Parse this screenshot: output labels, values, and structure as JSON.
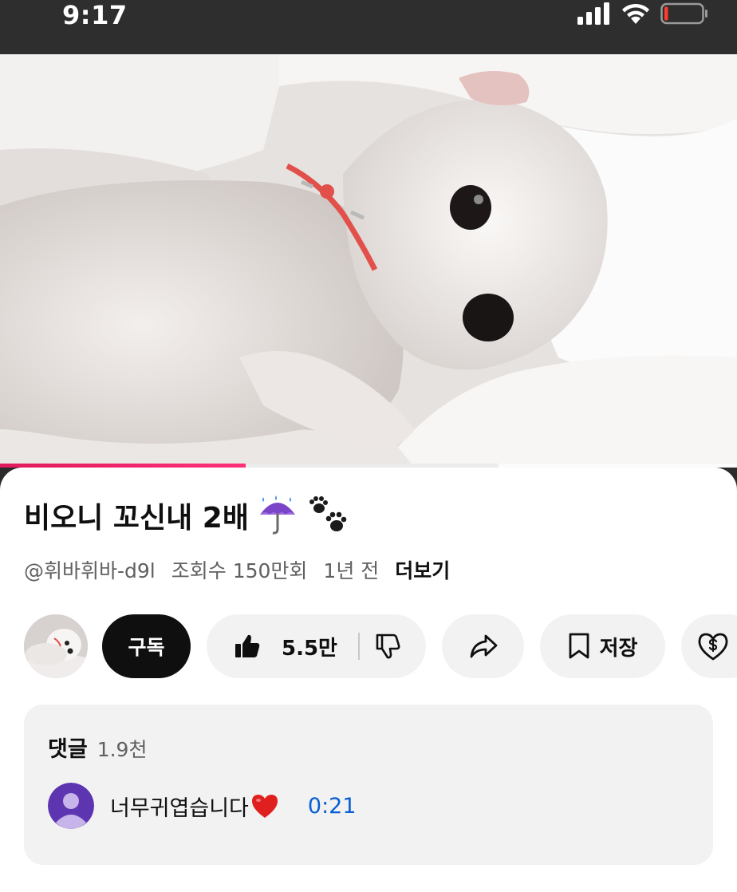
{
  "status_bar": {
    "time": "9:17",
    "battery_level": 0.1
  },
  "video": {
    "progress_played": 0.333,
    "progress_buffered": 0.676
  },
  "video_info": {
    "title": "비오니 꼬신내 2배",
    "title_emoji_1": "umbrella-with-rain-icon",
    "title_emoji_2": "paw-prints-icon",
    "channel": "@휘바휘바-d9l",
    "views": "조회수 150만회",
    "age": "1년 전",
    "more_label": "더보기"
  },
  "actions": {
    "subscribe_label": "구독",
    "like_count": "5.5만",
    "save_label": "저장"
  },
  "comments": {
    "label": "댓글",
    "count": "1.9천",
    "top_comment": {
      "text": "너무귀엽습니다",
      "emoji": "red-heart-icon",
      "timestamp": "0:21"
    }
  },
  "colors": {
    "progress": "#ff1f6d",
    "timestamp_link": "#065fd4",
    "subscribe_bg": "#0f0f0f"
  }
}
